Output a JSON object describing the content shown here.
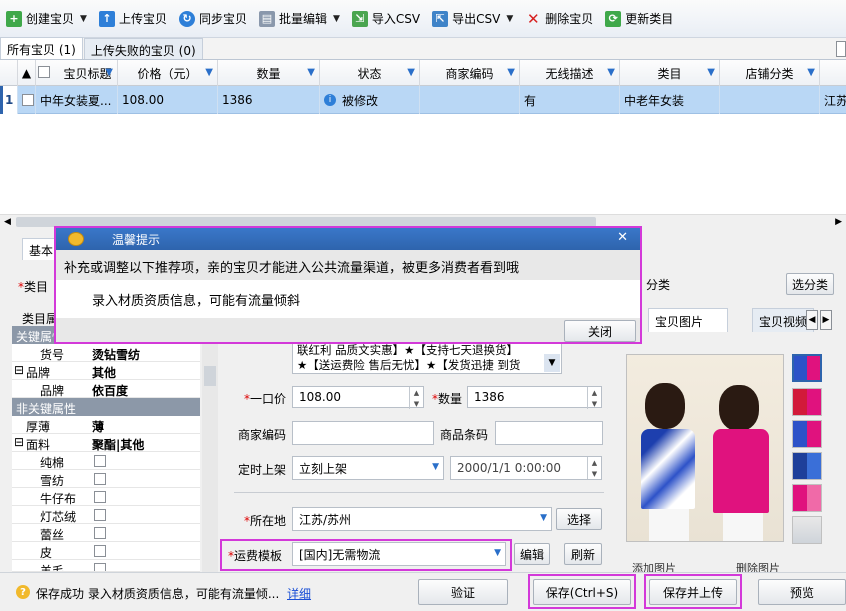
{
  "toolbar": {
    "create": "创建宝贝",
    "upload": "上传宝贝",
    "sync": "同步宝贝",
    "batch_edit": "批量编辑",
    "import_csv": "导入CSV",
    "export_csv": "导出CSV",
    "delete": "删除宝贝",
    "update_category": "更新类目"
  },
  "tabs": {
    "all": "所有宝贝 (1)",
    "failed": "上传失败的宝贝 (0)"
  },
  "grid": {
    "headers": [
      "宝贝标题",
      "价格（元）",
      "数量",
      "状态",
      "商家编码",
      "无线描述",
      "类目",
      "店铺分类"
    ],
    "row": {
      "index": "1",
      "title": "中年女装夏...",
      "price": "108.00",
      "quantity": "1386",
      "status": "被修改",
      "merchant_code": "",
      "wireless_desc": "有",
      "category": "中老年女装",
      "shop_category": "",
      "location_partial": "江苏"
    }
  },
  "dialog": {
    "title": "温馨提示",
    "message": "补充或调整以下推荐项，亲的宝贝才能进入公共流量渠道，被更多消费者看到哦",
    "item": "录入材质资质信息，可能有流量倾斜",
    "close_label": "关闭"
  },
  "lower": {
    "tab_basic": "基本",
    "label_category": "类目",
    "label_category_attr": "类目属",
    "shop_category_partial": "分类",
    "select_category_btn": "选分类",
    "tab_images": "宝贝图片",
    "tab_video": "宝贝视频",
    "title_text_line1": "联红利 品质文实惠】★【支持七天退换货】",
    "title_text_line2": "★【送运费险 售后无忧】★【发货迅捷 到货",
    "label_price": "一口价",
    "price_value": "108.00",
    "label_quantity": "数量",
    "quantity_value": "1386",
    "label_merchant_code": "商家编码",
    "label_barcode": "商品条码",
    "label_schedule": "定时上架",
    "schedule_value": "立刻上架",
    "datetime_value": "2000/1/1  0:00:00",
    "label_location": "所在地",
    "location_value": "江苏/苏州",
    "select_btn": "选择",
    "label_freight": "运费模板",
    "freight_value": "[国内]无需物流",
    "edit_btn": "编辑",
    "refresh_btn": "刷新",
    "add_image_partial": "添加图片",
    "delete_image_partial": "删除图片"
  },
  "attributes": {
    "key_section": "关键属性",
    "nonkey_section": "非关键属性",
    "rows": [
      {
        "k": "货号",
        "v": "烫钻雪纺"
      },
      {
        "k": "品牌",
        "v": "其他"
      },
      {
        "k": "品牌",
        "v": "依百度"
      }
    ],
    "rows2": [
      {
        "k": "厚薄",
        "v": "薄"
      },
      {
        "k": "面料",
        "v": "聚酯|其他"
      }
    ],
    "materials": [
      "纯棉",
      "雪纺",
      "牛仔布",
      "灯芯绒",
      "蕾丝",
      "皮",
      "羊毛"
    ]
  },
  "statusbar": {
    "message": "保存成功 录入材质资质信息，可能有流量倾...",
    "detail_link": "详细",
    "verify_btn": "验证",
    "save_btn": "保存(Ctrl+S)",
    "save_upload_btn": "保存并上传",
    "preview_btn": "预览"
  },
  "colors": {
    "highlight": "#d339d9",
    "selected_row": "#b9d7f5",
    "title_bar": "#3a77c9",
    "required": "#dd0000"
  }
}
